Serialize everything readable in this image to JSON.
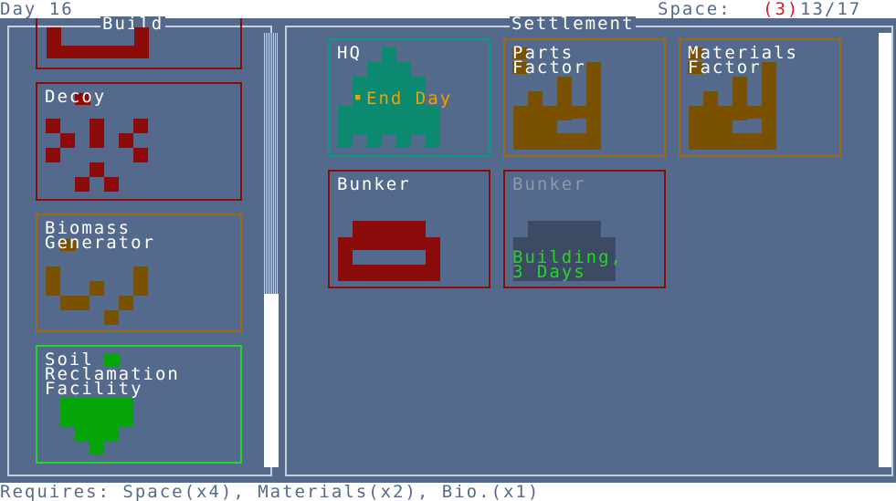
{
  "top_bar": {
    "day_label": "Day 16",
    "space_label": "Space:",
    "space_reserved": "(3)",
    "space_value": "13/17"
  },
  "build_panel": {
    "title": "Build",
    "items": [
      {
        "name": "",
        "status": "top cut-off"
      },
      {
        "name": "Decoy"
      },
      {
        "name": "Biomass\nGenerator"
      },
      {
        "name": "Soil\nReclamation\nFacility"
      }
    ]
  },
  "settlement_panel": {
    "title": "Settlement",
    "buildings": [
      {
        "name": "HQ",
        "action": "End Day",
        "marker": "■"
      },
      {
        "name": "Parts\nFactory"
      },
      {
        "name": "Materials\nFactory"
      },
      {
        "name": "Bunker"
      },
      {
        "name": "Bunker",
        "status": "Building,\n3 Days"
      }
    ]
  },
  "bottom_bar": {
    "requires_text": "Requires: Space(x4), Materials(x2), Bio.(x1)"
  },
  "colors": {
    "background": "#536a8c",
    "red": "#8b0a0a",
    "brown": "#7a5100",
    "teal": "#0b8a70",
    "green": "#06a506",
    "orange": "#f0a000",
    "reserved_red": "#e01818",
    "bright_green": "#26d626"
  }
}
